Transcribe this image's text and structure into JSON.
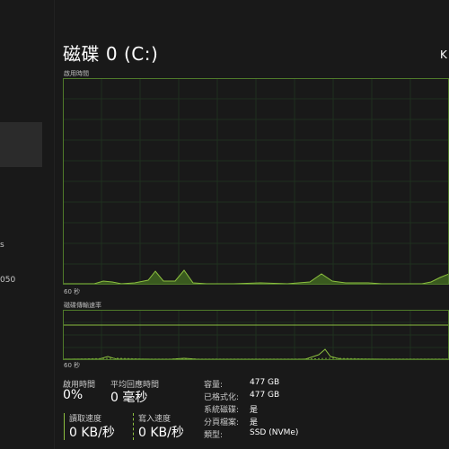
{
  "left_pane": {
    "fragments": [
      "s",
      "050"
    ]
  },
  "header": {
    "title": "磁碟 0 (C:)",
    "right_fragment": "K"
  },
  "active_time_chart": {
    "label": "啟用時間",
    "time_axis": "60 秒"
  },
  "transfer_chart": {
    "label": "磁碟傳輸速率",
    "time_axis": "60 秒"
  },
  "stats": {
    "active_time_label": "啟用時間",
    "active_time_value": "0%",
    "avg_response_label": "平均回應時間",
    "avg_response_value": "0 毫秒",
    "read_speed_label": "讀取速度",
    "read_speed_value": "0 KB/秒",
    "write_speed_label": "寫入速度",
    "write_speed_value": "0 KB/秒"
  },
  "properties": [
    {
      "label": "容量:",
      "value": "477 GB"
    },
    {
      "label": "已格式化:",
      "value": "477 GB"
    },
    {
      "label": "系統磁碟:",
      "value": "是"
    },
    {
      "label": "分頁檔案:",
      "value": "是"
    },
    {
      "label": "類型:",
      "value": "SSD (NVMe)"
    }
  ],
  "colors": {
    "accent": "#8cbf3f",
    "grid": "#1f3a1f",
    "border": "#4f7a2a"
  }
}
